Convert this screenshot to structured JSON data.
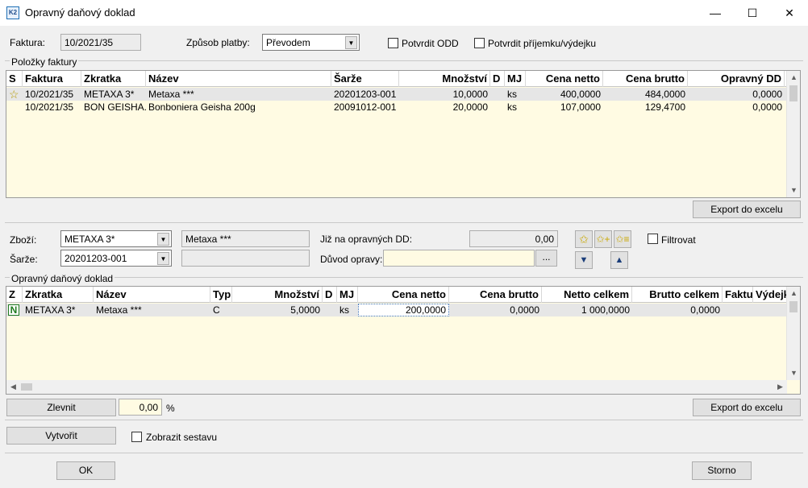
{
  "window": {
    "title": "Opravný daňový doklad",
    "app_badge": "K2",
    "minimize": "—",
    "maximize": "☐",
    "close": "✕"
  },
  "header": {
    "faktura_label": "Faktura:",
    "faktura_value": "10/2021/35",
    "zpusob_label": "Způsob platby:",
    "zpusob_value": "Převodem",
    "potvrdit_odd_label": "Potvrdit ODD",
    "potvrdit_prijemku_label": "Potvrdit příjemku/výdejku"
  },
  "polozky": {
    "group_label": "Položky faktury",
    "columns": [
      "S",
      "Faktura",
      "Zkratka",
      "Název",
      "Šarže",
      "Množství",
      "D",
      "MJ",
      "Cena netto",
      "Cena brutto",
      "Opravný DD"
    ],
    "rows": [
      {
        "s": "☆",
        "faktura": "10/2021/35",
        "zkratka": "METAXA 3*",
        "nazev": "Metaxa ***",
        "sarze": "20201203-001",
        "mnozstvi": "10,0000",
        "d": "",
        "mj": "ks",
        "cena_netto": "400,0000",
        "cena_brutto": "484,0000",
        "opravny": "0,0000"
      },
      {
        "s": "",
        "faktura": "10/2021/35",
        "zkratka": "BON GEISHA...",
        "nazev": "Bonboniera Geisha 200g",
        "sarze": "20091012-001",
        "mnozstvi": "20,0000",
        "d": "",
        "mj": "ks",
        "cena_netto": "107,0000",
        "cena_brutto": "129,4700",
        "opravny": "0,0000"
      }
    ],
    "export_label": "Export do excelu"
  },
  "detail": {
    "zbozi_label": "Zboží:",
    "zbozi_value": "METAXA 3*",
    "zbozi_name": "Metaxa ***",
    "sarze_label": "Šarže:",
    "sarze_value": "20201203-001",
    "sarze_name": "",
    "jiz_label": "Již na opravných DD:",
    "jiz_value": "0,00",
    "duvod_label": "Důvod opravy:",
    "duvod_value": "",
    "ellipsis": "...",
    "filtrovat_label": "Filtrovat"
  },
  "opravny": {
    "group_label": "Opravný daňový doklad",
    "columns": [
      "Z",
      "Zkratka",
      "Název",
      "Typ",
      "Množství",
      "D",
      "MJ",
      "Cena netto",
      "Cena brutto",
      "Netto celkem",
      "Brutto celkem",
      "Faktu",
      "Výdejk"
    ],
    "rows": [
      {
        "z": "N",
        "zkratka": "METAXA 3*",
        "nazev": "Metaxa ***",
        "typ": "C",
        "mnozstvi": "5,0000",
        "d": "",
        "mj": "ks",
        "cena_netto": "200,0000",
        "cena_brutto": "0,0000",
        "netto_celkem": "1 000,0000",
        "brutto_celkem": "0,0000",
        "faktu": "",
        "vydejk": ""
      }
    ],
    "zlevnit_label": "Zlevnit",
    "zlevnit_value": "0,00",
    "percent": "%",
    "export_label": "Export do excelu"
  },
  "footer": {
    "vytvorit_label": "Vytvořit",
    "zobrazit_label": "Zobrazit sestavu",
    "ok_label": "OK",
    "storno_label": "Storno"
  },
  "colors": {
    "grid_bg": "#fffbe3",
    "selected_row": "#e6e6e6",
    "z_badge": "#1e7a1e"
  }
}
